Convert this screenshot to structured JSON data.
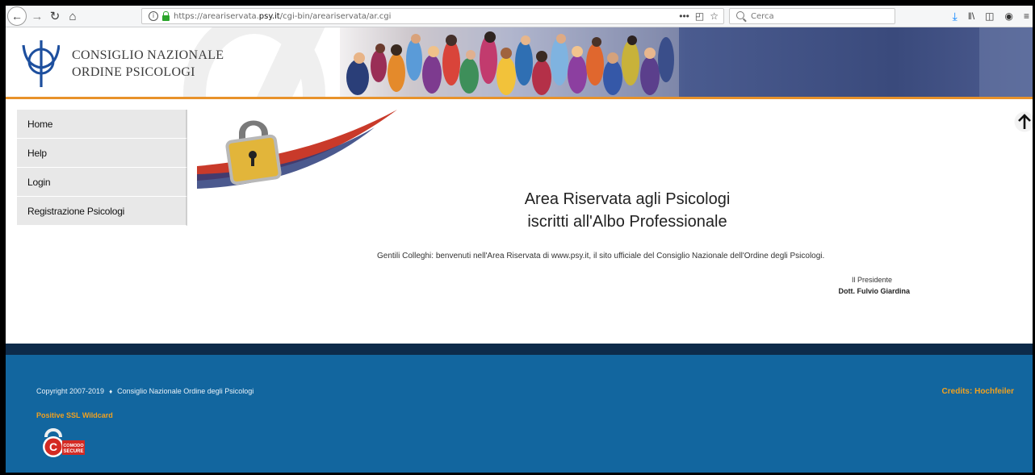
{
  "browser": {
    "url_scheme": "https://",
    "url_host": "areariservata.psy.it",
    "url_host_prefix": "areariservata.",
    "url_host_domain": "psy.it",
    "url_path": "/cgi-bin/areariservata/ar.cgi",
    "page_actions": "•••",
    "search_placeholder": "Cerca",
    "icons": [
      "back-arrow-icon",
      "forward-arrow-icon",
      "reload-icon",
      "home-icon",
      "info-icon",
      "lock-icon",
      "more-icon",
      "pocket-icon",
      "bookmark-star-icon",
      "search-icon",
      "download-icon",
      "library-icon",
      "sidebar-icon",
      "account-icon",
      "menu-icon"
    ]
  },
  "header": {
    "org_line1": "CONSIGLIO  NAZIONALE",
    "org_line2": "ORDINE  PSICOLOGI",
    "accent_color": "#e8922a"
  },
  "sidebar": {
    "items": [
      {
        "label": "Home"
      },
      {
        "label": "Help"
      },
      {
        "label": "Login"
      },
      {
        "label": "Registrazione Psicologi"
      }
    ]
  },
  "main": {
    "headline_line1": "Area Riservata agli Psicologi",
    "headline_line2": "iscritti all'Albo Professionale",
    "welcome_text": "Gentili Colleghi: benvenuti nell'Area Riservata di www.psy.it, il sito ufficiale del Consiglio Nazionale dell'Ordine degli Psicologi.",
    "president_role": "Il Presidente",
    "president_name": "Dott. Fulvio Giardina"
  },
  "footer": {
    "copyright": "Copyright 2007-2019",
    "separator": "♦",
    "org": "Consiglio Nazionale Ordine degli Psicologi",
    "ssl": "Positive SSL Wildcard",
    "credits": "Credits: Hochfeiler",
    "badge_line1": "COMODO",
    "badge_line2": "SECURE",
    "background_color": "#12669f",
    "highlight_color": "#f1a11f"
  }
}
